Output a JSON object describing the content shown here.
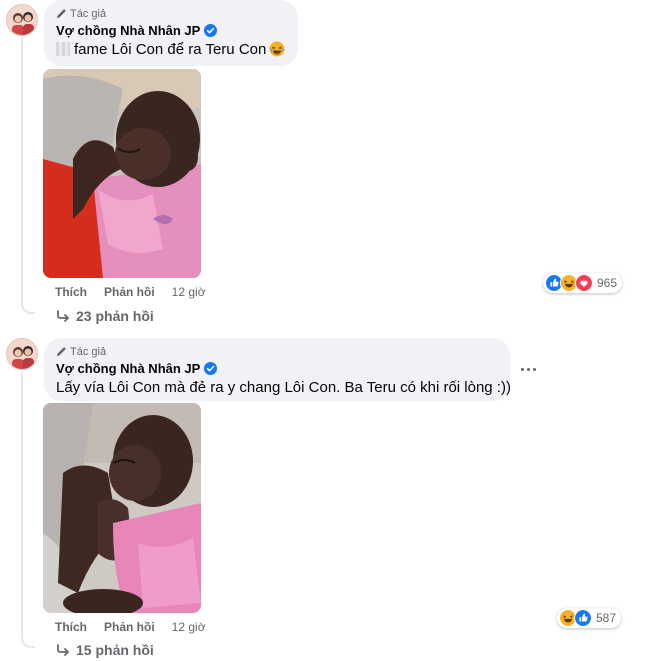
{
  "comments": [
    {
      "badge": "Tác giả",
      "author": "Vợ chồng Nhà Nhân JP",
      "text": "fame Lôi Con để ra Teru Con",
      "like_label": "Thích",
      "reply_label": "Phản hồi",
      "time": "12 giờ",
      "reaction_count": "965",
      "reactions": [
        "like-icon",
        "haha-icon",
        "love-icon"
      ],
      "replies_label": "23 phản hồi",
      "photo_alt": "sleeping baby in pink shirt"
    },
    {
      "badge": "Tác giả",
      "author": "Vợ chồng Nhà Nhân JP",
      "text": "Lấy vía Lôi Con mà đẻ ra y chang Lôi Con. Ba Teru có khi rối lòng :))",
      "like_label": "Thích",
      "reply_label": "Phản hồi",
      "time": "12 giờ",
      "reaction_count": "587",
      "reactions": [
        "haha-icon",
        "like-icon"
      ],
      "replies_label": "15 phản hồi",
      "photo_alt": "baby sleeping with hands near face"
    }
  ],
  "colors": {
    "bubble_bg": "#f0f2f5",
    "muted_text": "#65676b",
    "verified_blue": "#1877f2",
    "like_blue": "#1877f2",
    "love_red": "#f33e58",
    "haha_yellow": "#f7b125"
  }
}
